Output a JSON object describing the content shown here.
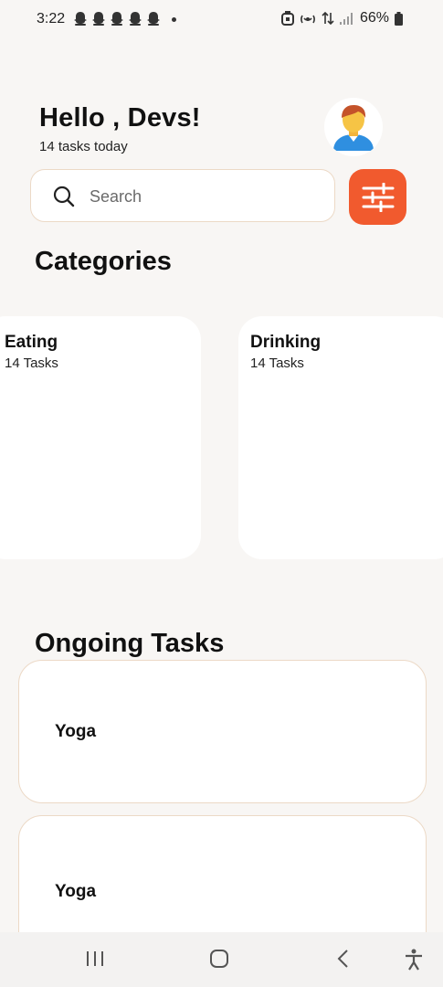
{
  "status_bar": {
    "time": "3:22",
    "battery": "66%",
    "notification_icons": [
      "snapchat-icon",
      "snapchat-icon",
      "snapchat-icon",
      "snapchat-icon",
      "snapchat-icon"
    ]
  },
  "header": {
    "greeting": "Hello , Devs!",
    "subtitle": "14 tasks today"
  },
  "search": {
    "placeholder": "Search"
  },
  "categories": {
    "title": "Categories",
    "items": [
      {
        "name": "Eating",
        "count": "14 Tasks"
      },
      {
        "name": "Drinking",
        "count": "14 Tasks"
      }
    ]
  },
  "ongoing": {
    "title": "Ongoing Tasks",
    "items": [
      {
        "name": "Yoga"
      },
      {
        "name": "Yoga"
      }
    ]
  },
  "colors": {
    "accent": "#f15a2e",
    "background": "#f8f6f4",
    "card_border": "#ecd9c6"
  }
}
